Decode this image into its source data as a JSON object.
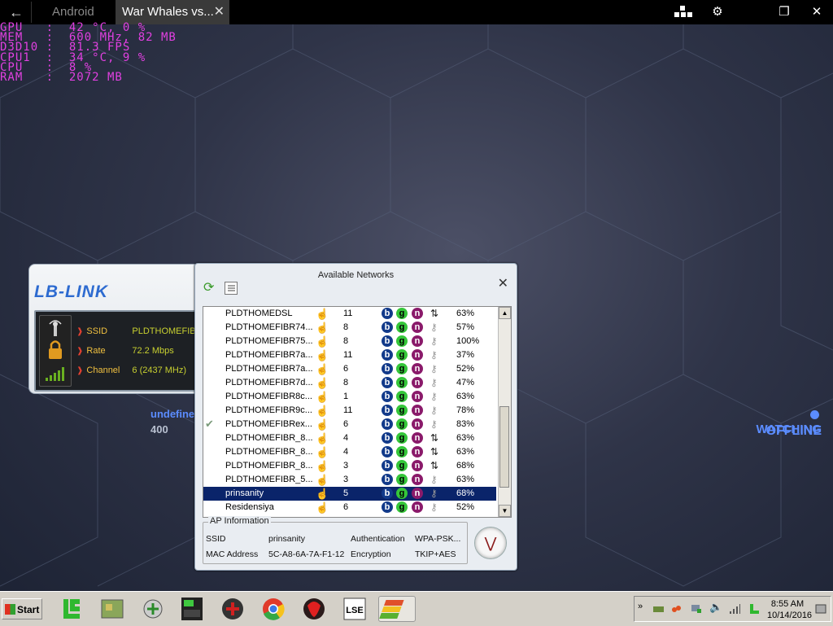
{
  "topbar": {
    "back_icon": "arrow-left-icon",
    "tabs": [
      {
        "label": "Android"
      },
      {
        "label": "War Whales vs..."
      }
    ],
    "controls": [
      "keymap-icon",
      "gear-icon",
      "restore-icon",
      "close-icon"
    ]
  },
  "osd": [
    "GPU   :  42 °C, 0 %",
    "MEM   :  600 MHz, 82 MB",
    "D3D10 :  81.3 FPS",
    "CPU1  :  34 °C, 9 %",
    "CPU   :  8 %",
    "RAM   :  2072 MB"
  ],
  "lblink": {
    "logo": "LB-LINK",
    "rows": [
      {
        "label": "SSID",
        "value": "PLDTHOMEFIB"
      },
      {
        "label": "Rate",
        "value": "72.2 Mbps"
      },
      {
        "label": "Channel",
        "value": "6 (2437 MHz)"
      }
    ]
  },
  "networks": {
    "title": "Available Networks",
    "rows": [
      {
        "name": "PLDTHOMEDSL",
        "channel": "11",
        "security": "open",
        "percent": "63%"
      },
      {
        "name": "PLDTHOMEFIBR74...",
        "channel": "8",
        "security": "key",
        "percent": "57%"
      },
      {
        "name": "PLDTHOMEFIBR75...",
        "channel": "8",
        "security": "key",
        "percent": "100%"
      },
      {
        "name": "PLDTHOMEFIBR7a...",
        "channel": "11",
        "security": "key",
        "percent": "37%"
      },
      {
        "name": "PLDTHOMEFIBR7a...",
        "channel": "6",
        "security": "key",
        "percent": "52%"
      },
      {
        "name": "PLDTHOMEFIBR7d...",
        "channel": "8",
        "security": "key",
        "percent": "47%"
      },
      {
        "name": "PLDTHOMEFIBR8c...",
        "channel": "1",
        "security": "key",
        "percent": "63%"
      },
      {
        "name": "PLDTHOMEFIBR9c...",
        "channel": "11",
        "security": "key",
        "percent": "78%"
      },
      {
        "name": "PLDTHOMEFIBRex...",
        "channel": "6",
        "security": "key",
        "percent": "83%",
        "connected": true
      },
      {
        "name": "PLDTHOMEFIBR_8...",
        "channel": "4",
        "security": "open",
        "percent": "63%"
      },
      {
        "name": "PLDTHOMEFIBR_8...",
        "channel": "4",
        "security": "open",
        "percent": "63%"
      },
      {
        "name": "PLDTHOMEFIBR_8...",
        "channel": "3",
        "security": "open",
        "percent": "68%"
      },
      {
        "name": "PLDTHOMEFIBR_5...",
        "channel": "3",
        "security": "key",
        "percent": "63%"
      },
      {
        "name": "prinsanity",
        "channel": "5",
        "security": "key",
        "percent": "68%",
        "selected": true
      },
      {
        "name": "Residensiya",
        "channel": "6",
        "security": "key",
        "percent": "52%"
      }
    ],
    "standards": [
      "b",
      "g",
      "n"
    ],
    "ap_info": {
      "legend": "AP Information",
      "ssid_label": "SSID",
      "ssid_value": "prinsanity",
      "auth_label": "Authentication",
      "auth_value": "WPA-PSK...",
      "mac_label": "MAC Address",
      "mac_value": "5C-A8-6A-7A-F1-12",
      "enc_label": "Encryption",
      "enc_value": "TKIP+AES"
    }
  },
  "desktop": {
    "undefined_text": "undefine",
    "number_text": "400",
    "watching_text": "WATCHING",
    "offline_text": "OFFLINE"
  },
  "taskbar": {
    "start_label": "Start",
    "apps": [
      "lb-link-icon",
      "map-icon",
      "network-icon",
      "gpu-z-icon",
      "crossfire-icon",
      "chrome-icon",
      "garena-icon",
      "lse-icon",
      "bluestacks-icon"
    ],
    "clock_time": "8:55 AM",
    "clock_date": "10/14/2016"
  }
}
